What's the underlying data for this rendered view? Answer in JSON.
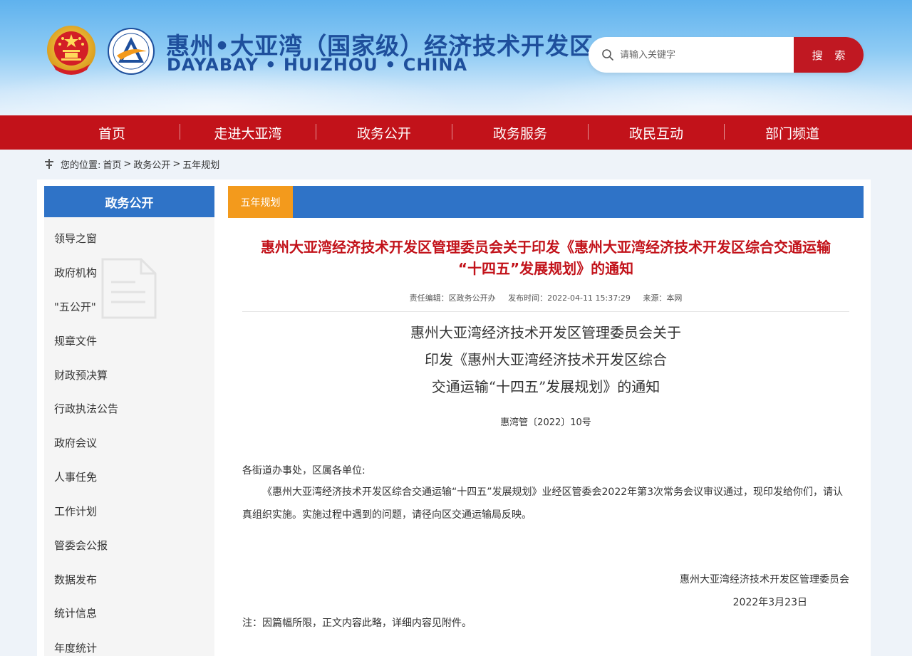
{
  "header": {
    "title_cn": "惠州•大亚湾（国家级）经济技术开发区",
    "title_en": "DAYABAY • HUIZHOU • CHINA",
    "search": {
      "placeholder": "请输入关键字",
      "button_label": "搜 索",
      "icon": "search-icon"
    }
  },
  "nav": {
    "items": [
      {
        "label": "首页"
      },
      {
        "label": "走进大亚湾"
      },
      {
        "label": "政务公开"
      },
      {
        "label": "政务服务"
      },
      {
        "label": "政民互动"
      },
      {
        "label": "部门频道"
      }
    ]
  },
  "breadcrumb": {
    "prefix": "您的位置:",
    "items": [
      "首页",
      ">",
      "政务公开",
      ">",
      "五年规划"
    ]
  },
  "sidebar": {
    "title": "政务公开",
    "items": [
      "领导之窗",
      "政府机构",
      "\"五公开\"",
      "规章文件",
      "财政预决算",
      "行政执法公告",
      "政府会议",
      "人事任免",
      "工作计划",
      "管委会公报",
      "数据发布",
      "统计信息",
      "年度统计"
    ]
  },
  "content": {
    "tab_label": "五年规划",
    "title_line1": "惠州大亚湾经济技术开发区管理委员会关于印发《惠州大亚湾经济技术开发区综合交通运输",
    "title_line2": "“十四五”发展规划》的通知",
    "meta": {
      "editor": "责任编辑：区政务公开办",
      "published": "发布时间：2022-04-11 15:37:29",
      "source": "来源：本网"
    },
    "doc_heading": [
      "惠州大亚湾经济技术开发区管理委员会关于",
      "印发《惠州大亚湾经济技术开发区综合",
      "交通运输“十四五”发展规划》的通知"
    ],
    "doc_number": "惠湾管〔2022〕10号",
    "salutation": "各街道办事处，区属各单位:",
    "body": "《惠州大亚湾经济技术开发区综合交通运输“十四五”发展规划》业经区管委会2022年第3次常务会议审议通过，现印发给你们，请认真组织实施。实施过程中遇到的问题，请径向区交通运输局反映。",
    "signature_org": "惠州大亚湾经济技术开发区管理委员会",
    "signature_date": "2022年3月23日",
    "note": "注：因篇幅所限，正文内容此略，详细内容见附件。"
  },
  "colors": {
    "nav_red": "#c2121a",
    "title_blue": "#1e4f9c",
    "sidebar_blue": "#2f73c7",
    "tab_orange": "#f39a1c"
  }
}
